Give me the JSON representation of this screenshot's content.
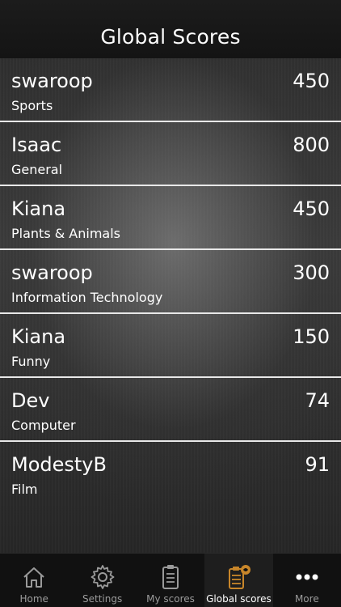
{
  "header": {
    "title": "Global Scores"
  },
  "scores": [
    {
      "name": "swaroop",
      "category": "Sports",
      "score": "450"
    },
    {
      "name": "Isaac",
      "category": "General",
      "score": "800"
    },
    {
      "name": "Kiana",
      "category": "Plants & Animals",
      "score": "450"
    },
    {
      "name": "swaroop",
      "category": "Information Technology",
      "score": "300"
    },
    {
      "name": "Kiana",
      "category": "Funny",
      "score": "150"
    },
    {
      "name": "Dev",
      "category": "Computer",
      "score": "74"
    },
    {
      "name": "ModestyB",
      "category": "Film",
      "score": "91"
    }
  ],
  "tabbar": {
    "items": [
      {
        "label": "Home",
        "icon": "home-icon"
      },
      {
        "label": "Settings",
        "icon": "gear-icon"
      },
      {
        "label": "My scores",
        "icon": "clipboard-icon"
      },
      {
        "label": "Global scores",
        "icon": "global-scores-icon",
        "active": true
      },
      {
        "label": "More",
        "icon": "more-dots-icon"
      }
    ]
  },
  "colors": {
    "active_icon": "#c8862a",
    "inactive_icon": "#9a9a9a"
  }
}
